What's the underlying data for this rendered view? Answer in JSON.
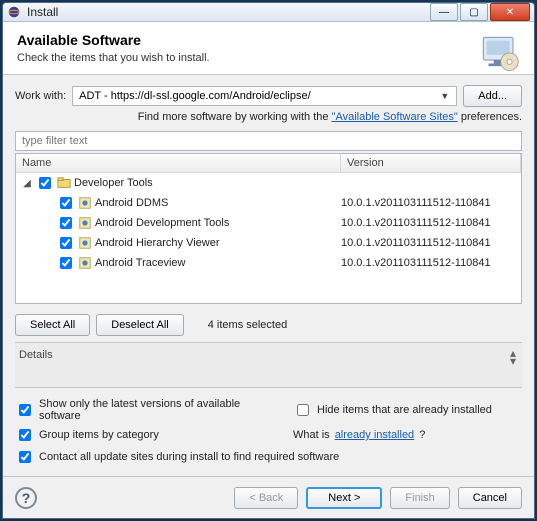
{
  "window": {
    "title": "Install"
  },
  "header": {
    "title": "Available Software",
    "subtitle": "Check the items that you wish to install."
  },
  "workwith": {
    "label": "Work with:",
    "value": "ADT - https://dl-ssl.google.com/Android/eclipse/",
    "add": "Add...",
    "hint_prefix": "Find more software by working with the ",
    "hint_link": "\"Available Software Sites\"",
    "hint_suffix": " preferences."
  },
  "filter": {
    "placeholder": "type filter text"
  },
  "columns": {
    "name": "Name",
    "version": "Version"
  },
  "tree": {
    "group": {
      "label": "Developer Tools"
    },
    "items": [
      {
        "label": "Android DDMS",
        "version": "10.0.1.v201103111512-110841"
      },
      {
        "label": "Android Development Tools",
        "version": "10.0.1.v201103111512-110841"
      },
      {
        "label": "Android Hierarchy Viewer",
        "version": "10.0.1.v201103111512-110841"
      },
      {
        "label": "Android Traceview",
        "version": "10.0.1.v201103111512-110841"
      }
    ]
  },
  "selection": {
    "select_all": "Select All",
    "deselect_all": "Deselect All",
    "status": "4 items selected"
  },
  "details": {
    "label": "Details"
  },
  "options": {
    "latest": "Show only the latest versions of available software",
    "hide_installed": "Hide items that are already installed",
    "group": "Group items by category",
    "whatis_prefix": "What is ",
    "whatis_link": "already installed",
    "whatis_suffix": "?",
    "contact": "Contact all update sites during install to find required software"
  },
  "footer": {
    "back": "< Back",
    "next": "Next >",
    "finish": "Finish",
    "cancel": "Cancel"
  }
}
